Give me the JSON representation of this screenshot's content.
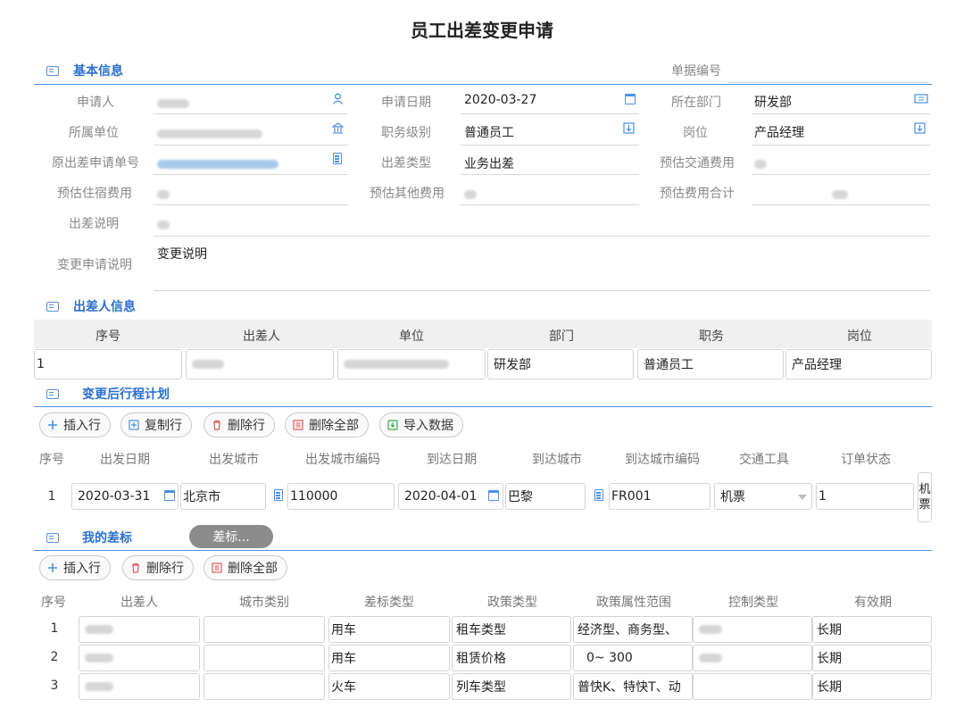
{
  "title": "员工出差变更申请",
  "basic": {
    "section_title": "基本信息",
    "doc_no_label": "单据编号",
    "applicant_label": "申请人",
    "apply_date_label": "申请日期",
    "apply_date": "2020-03-27",
    "dept_label": "所在部门",
    "dept": "研发部",
    "unit_label": "所属单位",
    "level_label": "职务级别",
    "level": "普通员工",
    "post_label": "岗位",
    "post": "产品经理",
    "orig_no_label": "原出差申请单号",
    "trip_type_label": "出差类型",
    "trip_type": "业务出差",
    "est_transport_label": "预估交通费用",
    "est_hotel_label": "预估住宿费用",
    "est_other_label": "预估其他费用",
    "est_total_label": "预估费用合计",
    "trip_desc_label": "出差说明",
    "change_desc_label": "变更申请说明",
    "change_desc": "变更说明"
  },
  "traveler": {
    "section_title": "出差人信息",
    "headers": [
      "序号",
      "出差人",
      "单位",
      "部门",
      "职务",
      "岗位"
    ],
    "row": {
      "no": "1",
      "dept": "研发部",
      "level": "普通员工",
      "post": "产品经理"
    }
  },
  "itinerary": {
    "section_title": "变更后行程计划",
    "buttons": [
      "插入行",
      "复制行",
      "删除行",
      "删除全部",
      "导入数据"
    ],
    "headers": [
      "序号",
      "出发日期",
      "出发城市",
      "出发城市编码",
      "到达日期",
      "到达城市",
      "到达城市编码",
      "交通工具",
      "订单状态"
    ],
    "row": {
      "no": "1",
      "depart_date": "2020-03-31",
      "depart_city": "北京市",
      "depart_code": "110000",
      "arrive_date": "2020-04-01",
      "arrive_city": "巴黎",
      "arrive_code": "FR001",
      "transport": "机票",
      "order_status": "1",
      "overflow_1": "机",
      "overflow_2": "票"
    }
  },
  "standard": {
    "section_title": "我的差标",
    "pill_label": "差标...",
    "buttons": [
      "插入行",
      "删除行",
      "删除全部"
    ],
    "headers": [
      "序号",
      "出差人",
      "城市类别",
      "差标类型",
      "政策类型",
      "政策属性范围",
      "控制类型",
      "有效期"
    ],
    "rows": [
      {
        "no": "1",
        "std_type": "用车",
        "policy_type": "租车类型",
        "range": "经济型、商务型、",
        "validity": "长期"
      },
      {
        "no": "2",
        "std_type": "用车",
        "policy_type": "租赁价格",
        "range": "0~  300",
        "validity": "长期"
      },
      {
        "no": "3",
        "std_type": "火车",
        "policy_type": "列车类型",
        "range": "普快K、特快T、动",
        "validity": "长期"
      }
    ]
  },
  "colors": {
    "accent": "#2b6fd0",
    "rule": "#4a90e2",
    "icon": "#4a90e2"
  }
}
